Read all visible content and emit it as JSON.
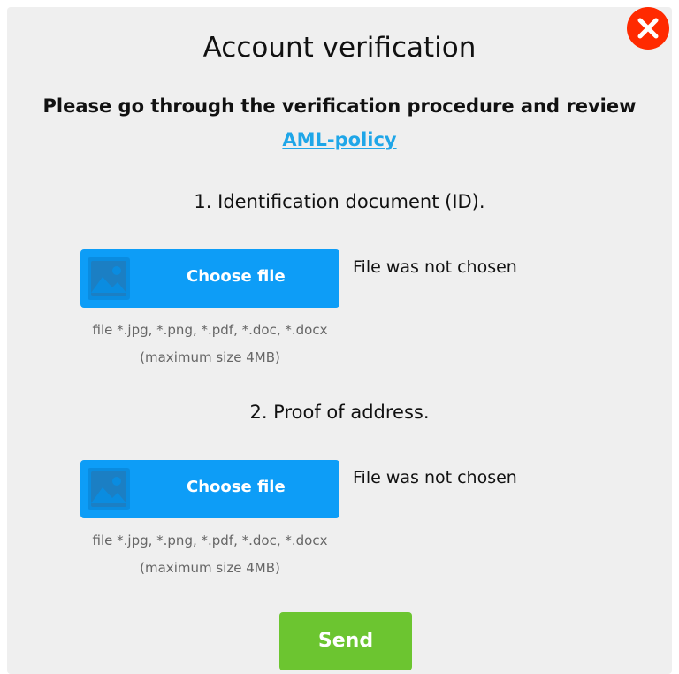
{
  "modal": {
    "title": "Account verification",
    "intro_text": "Please go through the verification procedure and review",
    "aml_link": "AML-policy"
  },
  "sections": [
    {
      "heading": "1. Identification document (ID).",
      "choose_label": "Choose file",
      "status": "File was not chosen",
      "hint_formats": "file *.jpg, *.png, *.pdf, *.doc, *.docx",
      "hint_size": "(maximum size 4MB)",
      "icon": "image-icon"
    },
    {
      "heading": "2. Proof of address.",
      "choose_label": "Choose file",
      "status": "File was not chosen",
      "hint_formats": "file *.jpg, *.png, *.pdf, *.doc, *.docx",
      "hint_size": "(maximum size 4MB)",
      "icon": "image-icon"
    }
  ],
  "actions": {
    "send_label": "Send",
    "close_icon": "close-icon"
  },
  "colors": {
    "close": "#ff2a00",
    "file_button": "#0d9df7",
    "send_button": "#6cc530",
    "link": "#1fa6e8",
    "background": "#efefef"
  }
}
